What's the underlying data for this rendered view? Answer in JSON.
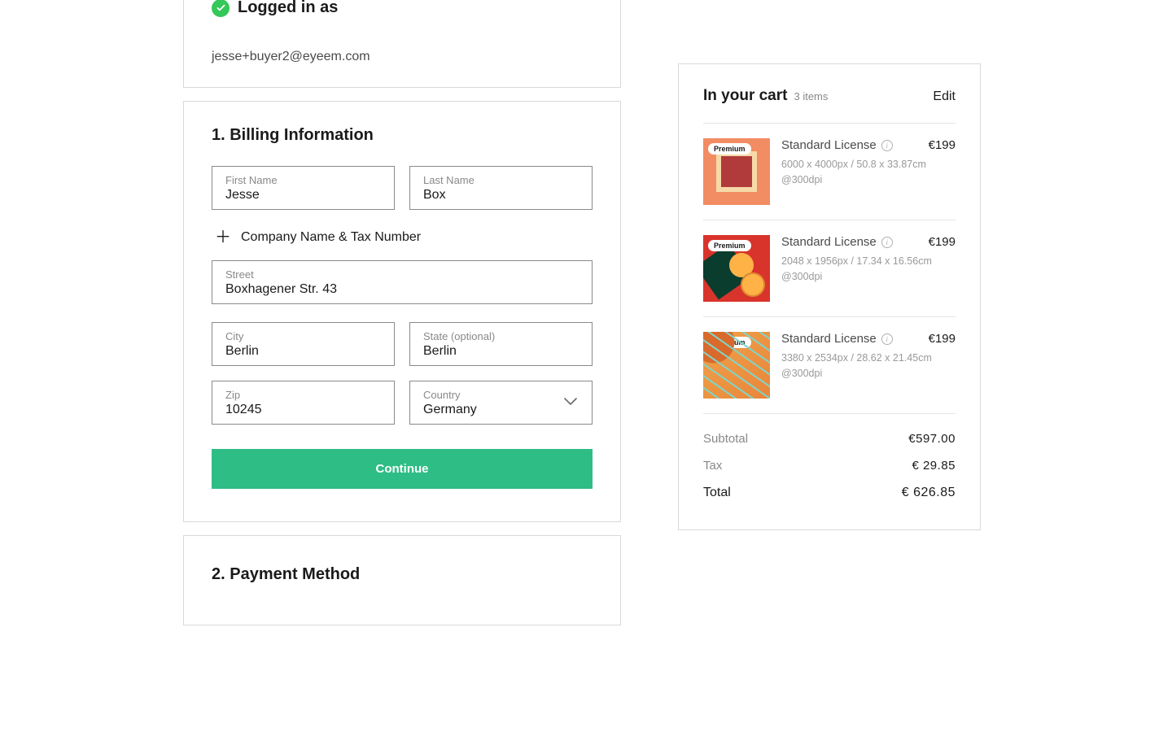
{
  "login": {
    "title": "Logged in as",
    "email": "jesse+buyer2@eyeem.com"
  },
  "billing": {
    "title": "1. Billing Information",
    "first_name_label": "First Name",
    "first_name_value": "Jesse",
    "last_name_label": "Last Name",
    "last_name_value": "Box",
    "add_company_label": "Company Name & Tax Number",
    "street_label": "Street",
    "street_value": "Boxhagener Str. 43",
    "city_label": "City",
    "city_value": "Berlin",
    "state_label": "State (optional)",
    "state_value": "Berlin",
    "zip_label": "Zip",
    "zip_value": "10245",
    "country_label": "Country",
    "country_value": "Germany",
    "continue_label": "Continue"
  },
  "payment": {
    "title": "2. Payment Method"
  },
  "cart": {
    "title": "In your cart",
    "count": "3 items",
    "edit_label": "Edit",
    "badge_label": "Premium",
    "items": [
      {
        "license": "Standard License",
        "price": "€199",
        "meta1": "6000 x 4000px / 50.8 x 33.87cm",
        "meta2": "@300dpi"
      },
      {
        "license": "Standard License",
        "price": "€199",
        "meta1": "2048 x 1956px / 17.34 x 16.56cm",
        "meta2": "@300dpi"
      },
      {
        "license": "Standard License",
        "price": "€199",
        "meta1": "3380 x 2534px / 28.62 x 21.45cm",
        "meta2": "@300dpi"
      }
    ],
    "totals": {
      "subtotal_label": "Subtotal",
      "subtotal_value": "€597.00",
      "tax_label": "Tax",
      "tax_value": "€ 29.85",
      "total_label": "Total",
      "total_value": "€ 626.85"
    }
  }
}
